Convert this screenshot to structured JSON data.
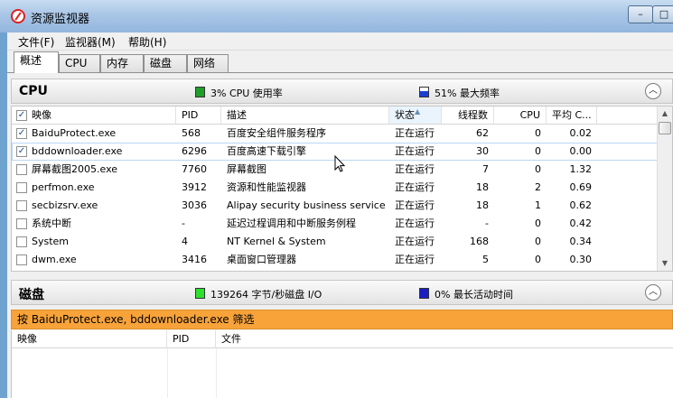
{
  "window": {
    "title": "资源监视器",
    "minimize": "–",
    "maximize": "□"
  },
  "menu": [
    "文件(F)",
    "监视器(M)",
    "帮助(H)"
  ],
  "tabs": [
    "概述",
    "CPU",
    "内存",
    "磁盘",
    "网络"
  ],
  "cpu": {
    "title": "CPU",
    "usage_text": "3% CPU 使用率",
    "freq_text": "51% 最大频率",
    "usage_color": "#1f9e2a",
    "freq_color": "#1a3fd4",
    "columns": [
      "映像",
      "PID",
      "描述",
      "状态",
      "线程数",
      "CPU",
      "平均 C..."
    ],
    "sorted_column": "状态",
    "rows": [
      {
        "checked": true,
        "image": "BaiduProtect.exe",
        "pid": "568",
        "desc": "百度安全组件服务程序",
        "status": "正在运行",
        "threads": "62",
        "cpu": "0",
        "avg": "0.02"
      },
      {
        "checked": true,
        "image": "bddownloader.exe",
        "pid": "6296",
        "desc": "百度高速下载引擎",
        "status": "正在运行",
        "threads": "30",
        "cpu": "0",
        "avg": "0.00"
      },
      {
        "checked": false,
        "image": "屏幕截图2005.exe",
        "pid": "7760",
        "desc": "屏幕截图",
        "status": "正在运行",
        "threads": "7",
        "cpu": "0",
        "avg": "1.32"
      },
      {
        "checked": false,
        "image": "perfmon.exe",
        "pid": "3912",
        "desc": "资源和性能监视器",
        "status": "正在运行",
        "threads": "18",
        "cpu": "2",
        "avg": "0.69"
      },
      {
        "checked": false,
        "image": "secbizsrv.exe",
        "pid": "3036",
        "desc": "Alipay security business service",
        "status": "正在运行",
        "threads": "18",
        "cpu": "1",
        "avg": "0.62"
      },
      {
        "checked": false,
        "image": "系统中断",
        "pid": "-",
        "desc": "延迟过程调用和中断服务例程",
        "status": "正在运行",
        "threads": "-",
        "cpu": "0",
        "avg": "0.42"
      },
      {
        "checked": false,
        "image": "System",
        "pid": "4",
        "desc": "NT Kernel & System",
        "status": "正在运行",
        "threads": "168",
        "cpu": "0",
        "avg": "0.34"
      },
      {
        "checked": false,
        "image": "dwm.exe",
        "pid": "3416",
        "desc": "桌面窗口管理器",
        "status": "正在运行",
        "threads": "5",
        "cpu": "0",
        "avg": "0.30"
      }
    ]
  },
  "disk": {
    "title": "磁盘",
    "io_text": "139264 字节/秒磁盘 I/O",
    "active_text": "0% 最长活动时间",
    "io_color": "#2ee02e",
    "active_color": "#1a1fc4",
    "filter_text": "按 BaiduProtect.exe, bddownloader.exe 筛选",
    "filter_color": "#f8a33a",
    "columns": [
      "映像",
      "PID",
      "文件"
    ]
  }
}
